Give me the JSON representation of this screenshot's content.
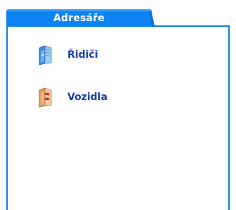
{
  "panel": {
    "title": "Adresáře"
  },
  "items": [
    {
      "label": "Řidiči",
      "icon": "blue-folder-icon",
      "color": "#5aa6e0"
    },
    {
      "label": "Vozidla",
      "icon": "orange-folder-icon",
      "color": "#f0b07a"
    }
  ],
  "colors": {
    "accent": "#0b84f2",
    "link": "#0b3fa8"
  }
}
